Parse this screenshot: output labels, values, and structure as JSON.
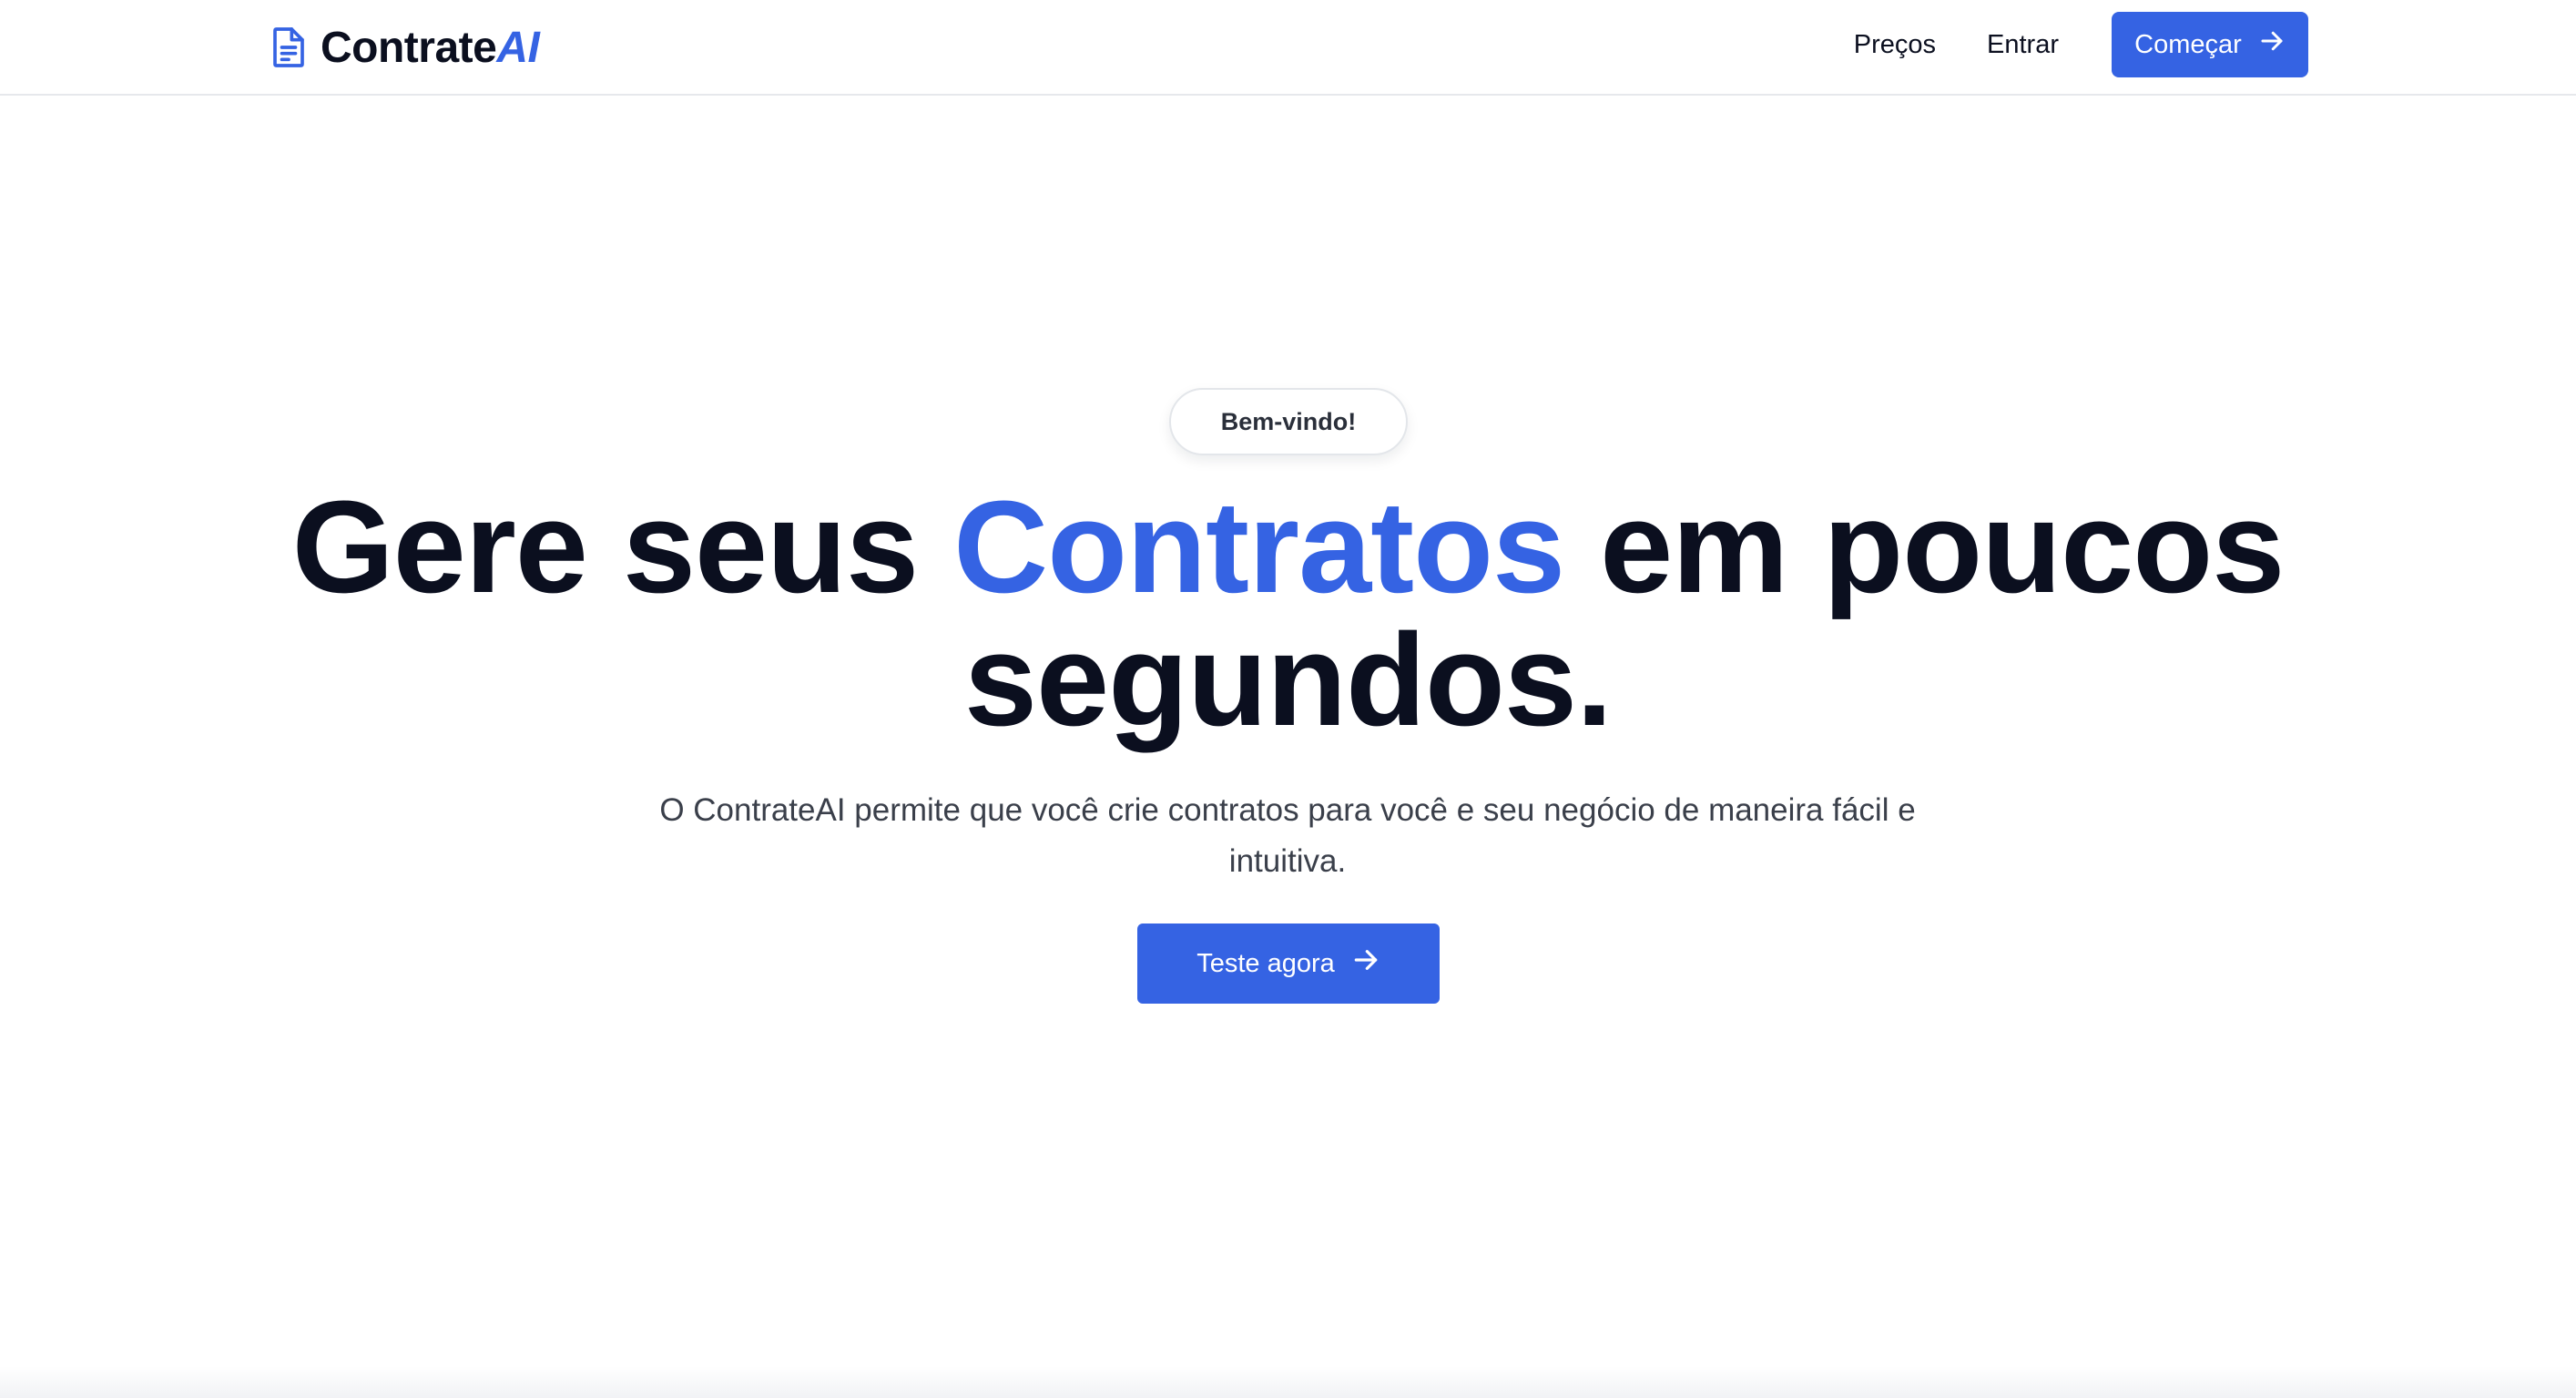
{
  "brand": {
    "name_main": "Contrate",
    "name_accent": "AI",
    "icon": "document-icon",
    "accent_color": "#3563e3"
  },
  "nav": {
    "links": [
      {
        "label": "Preços"
      },
      {
        "label": "Entrar"
      }
    ],
    "cta_label": "Começar",
    "cta_icon": "arrow-right-icon"
  },
  "hero": {
    "badge": "Bem-vindo!",
    "headline_part1": "Gere seus ",
    "headline_accent": "Contratos",
    "headline_part2": " em poucos segundos.",
    "subtitle": "O ContrateAI permite que você crie contratos para você e seu negócio de maneira fácil e intuitiva.",
    "cta_label": "Teste agora",
    "cta_icon": "arrow-right-icon"
  },
  "colors": {
    "primary": "#3563e3",
    "text": "#0b0f1f",
    "muted": "#3a3f4a",
    "border": "#e6e8ec"
  }
}
